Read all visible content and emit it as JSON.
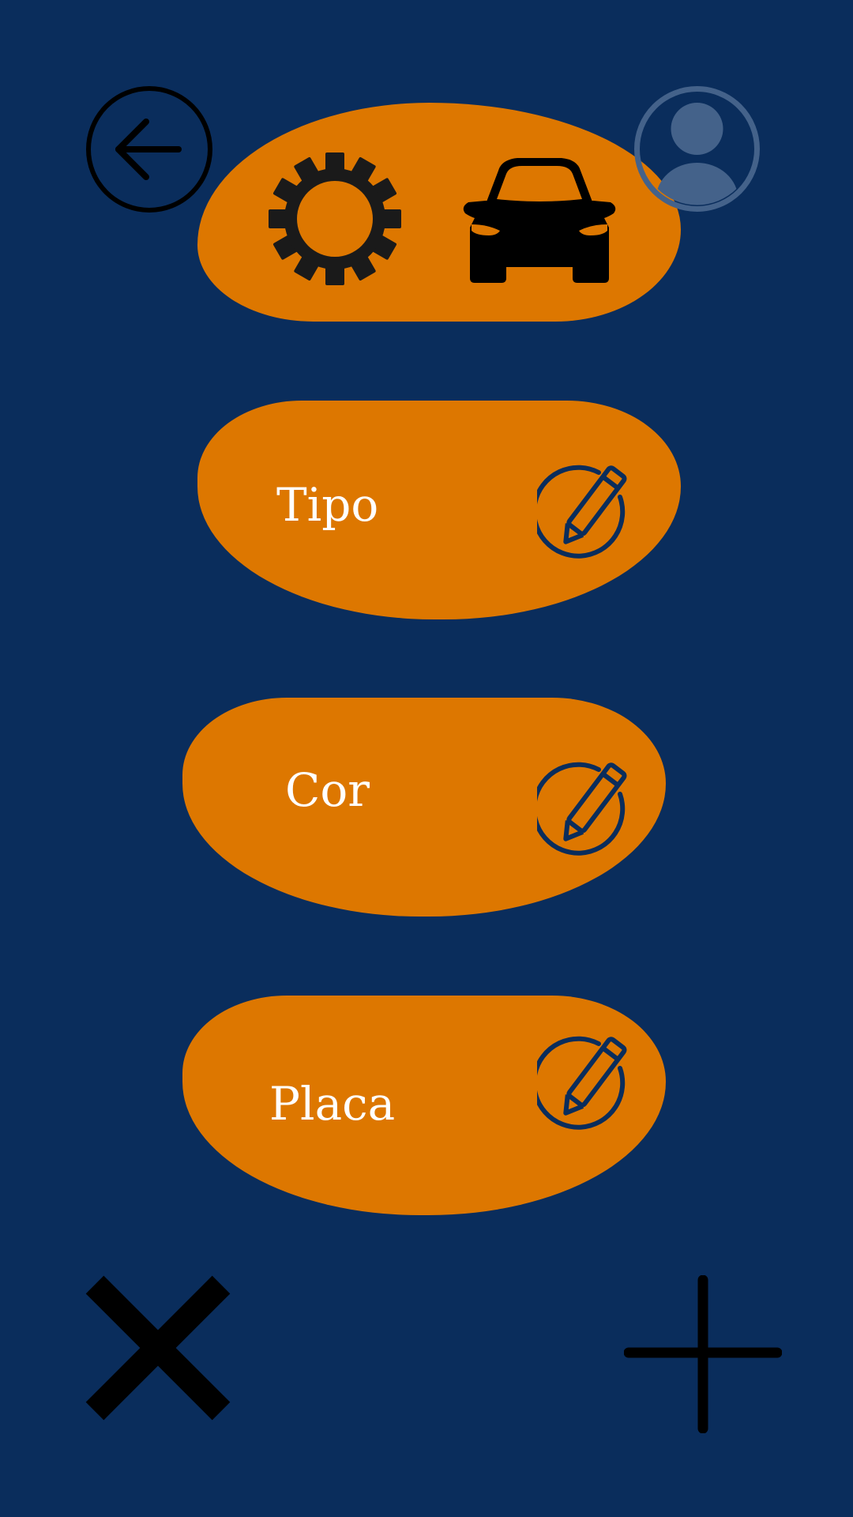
{
  "colors": {
    "background": "#0a2d5c",
    "accent": "#dd7700",
    "text": "#ffffff",
    "icon_dark": "#000000",
    "edit_icon": "#0a2d5c",
    "profile_icon": "#44628a"
  },
  "header": {
    "icons": [
      "gear-icon",
      "car-icon"
    ]
  },
  "fields": [
    {
      "label": "Tipo",
      "icon": "edit-icon"
    },
    {
      "label": "Cor",
      "icon": "edit-icon"
    },
    {
      "label": "Placa",
      "icon": "edit-icon"
    }
  ],
  "actions": {
    "back_icon": "back-arrow-icon",
    "profile_icon": "user-profile-icon",
    "cancel_icon": "close-icon",
    "add_icon": "plus-icon"
  }
}
